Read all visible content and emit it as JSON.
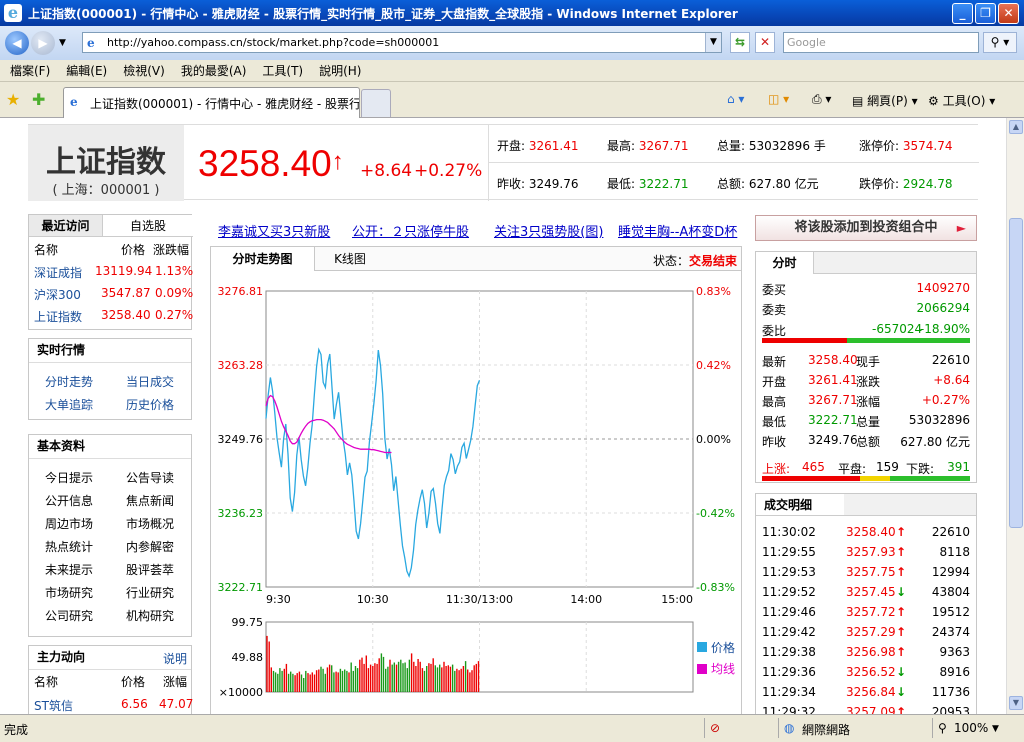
{
  "window": {
    "title": "上证指数(000001) - 行情中心 - 雅虎财经 - 股票行情_实时行情_股市_证券_大盘指数_全球股指 - Windows Internet Explorer",
    "address": "http://yahoo.compass.cn/stock/market.php?code=sh000001",
    "search_placeholder": "Google",
    "tab_title": "上证指数(000001) - 行情中心 - 雅虎财经 - 股票行...",
    "menu": [
      "檔案(F)",
      "編輯(E)",
      "檢視(V)",
      "我的最愛(A)",
      "工具(T)",
      "說明(H)"
    ],
    "toolbar_page": "網頁(P)",
    "toolbar_tools": "工具(O)",
    "status": "完成",
    "zone": "網際網路",
    "zoom": "100%"
  },
  "stock": {
    "name": "上证指数",
    "code": "( 上海：000001 )",
    "price": "3258.40",
    "change": "+8.64",
    "change_pct": "+0.27%",
    "quotes": [
      {
        "label": "开盘:",
        "value": "3261.41",
        "color": "red"
      },
      {
        "label": "最高:",
        "value": "3267.71",
        "color": "red"
      },
      {
        "label": "总量:",
        "value": "53032896 手",
        "color": "black"
      },
      {
        "label": "涨停价:",
        "value": "3574.74",
        "color": "red"
      },
      {
        "label": "昨收:",
        "value": "3249.76",
        "color": "black"
      },
      {
        "label": "最低:",
        "value": "3222.71",
        "color": "green"
      },
      {
        "label": "总额:",
        "value": "627.80 亿元",
        "color": "black"
      },
      {
        "label": "跌停价:",
        "value": "2924.78",
        "color": "green"
      }
    ]
  },
  "recent": {
    "tab_recent": "最近访问",
    "tab_watch": "自选股",
    "headers": [
      "名称",
      "价格",
      "涨跌幅"
    ],
    "rows": [
      {
        "name": "深证成指",
        "price": "13119.94",
        "pct": "1.13%"
      },
      {
        "name": "沪深300",
        "price": "3547.87",
        "pct": "0.09%"
      },
      {
        "name": "上证指数",
        "price": "3258.40",
        "pct": "0.27%"
      }
    ]
  },
  "realtime": {
    "title": "实时行情",
    "links": [
      "分时走势",
      "当日成交",
      "大单追踪",
      "历史价格"
    ]
  },
  "basics": {
    "title": "基本资料",
    "links": [
      "今日提示",
      "公告导读",
      "公开信息",
      "焦点新闻",
      "周边市场",
      "市场概况",
      "热点统计",
      "内参解密",
      "未来提示",
      "股评荟萃",
      "市场研究",
      "行业研究",
      "公司研究",
      "机构研究"
    ]
  },
  "main_force": {
    "title": "主力动向",
    "help": "说明",
    "headers": [
      "名称",
      "价格",
      "涨幅"
    ],
    "rows": [
      {
        "name": "ST筑信",
        "price": "6.56",
        "pct": "47.07"
      }
    ]
  },
  "news": [
    "李嘉诚又买3只新股",
    "公开：２只涨停牛股",
    "关注3只强势股(图)",
    "睡觉丰胸--A杯变D杯"
  ],
  "add_portfolio": "将该股添加到投资组合中",
  "chart": {
    "tab_intraday": "分时走势图",
    "tab_kline": "K线图",
    "state_label": "状态：",
    "state_value": "交易结束",
    "legend_price": "价格",
    "legend_avg": "均线",
    "vol_unit": "×10000"
  },
  "chart_data": {
    "type": "line",
    "y_ticks": [
      "3276.81",
      "3263.28",
      "3249.76",
      "3236.23",
      "3222.71"
    ],
    "pct_ticks": [
      "0.83%",
      "0.42%",
      "0.00%",
      "-0.42%",
      "-0.83%"
    ],
    "x_ticks": [
      "9:30",
      "10:30",
      "11:30/13:00",
      "14:00",
      "15:00"
    ],
    "ylim": [
      3222.71,
      3276.81
    ],
    "prev_close": 3249.76,
    "vol_ticks": [
      "99.75",
      "49.88"
    ],
    "vol_max": 99.75,
    "series": [
      {
        "name": "价格",
        "color": "#29a8e0",
        "values": [
          3253.5,
          3257.8,
          3261.0,
          3258.5,
          3254.5,
          3250.0,
          3247.2,
          3244.6,
          3249.8,
          3252.5,
          3247.0,
          3239.0,
          3236.5,
          3240.0,
          3246.8,
          3250.1,
          3246.0,
          3243.0,
          3241.2,
          3244.5,
          3249.0,
          3252.4,
          3258.0,
          3263.0,
          3266.1,
          3265.2,
          3260.1,
          3259.2,
          3263.5,
          3265.3,
          3259.2,
          3253.4,
          3256.1,
          3258.3,
          3254.0,
          3249.8,
          3247.1,
          3243.2,
          3245.4,
          3243.2,
          3238.4,
          3232.9,
          3231.5,
          3234.3,
          3238.5,
          3242.8,
          3243.9,
          3249.2,
          3252.6,
          3256.3,
          3260.4,
          3266.0,
          3263.2,
          3258.0,
          3249.8,
          3246.1,
          3248.0,
          3245.1,
          3240.3,
          3242.9,
          3238.5,
          3234.1,
          3230.2,
          3228.1,
          3225.6,
          3224.7,
          3226.2,
          3229.4,
          3234.1,
          3236.8,
          3238.9,
          3240.5,
          3238.0,
          3233.5,
          3236.2,
          3240.2,
          3240.7,
          3238.0,
          3234.3,
          3232.5,
          3237.1,
          3241.3,
          3242.9,
          3244.0,
          3247.1,
          3246.0,
          3243.4,
          3244.8,
          3245.6,
          3248.2,
          3249.0,
          3246.2,
          3247.8,
          3249.5,
          3252.0,
          3255.8,
          3259.5,
          3260.5
        ]
      },
      {
        "name": "均线",
        "color": "#e000c8",
        "values": [
          3255.8,
          3257.2,
          3257.7,
          3257.5,
          3256.7,
          3255.6,
          3254.3,
          3253.0,
          3252.0,
          3251.2,
          3250.4,
          3249.4,
          3248.9,
          3248.9,
          3249.2,
          3250.0,
          3250.8,
          3251.5,
          3252.1,
          3252.6,
          3252.9,
          3253.1,
          3253.2,
          3253.3,
          3253.3,
          3253.3,
          3253.2,
          3253.0,
          3252.8,
          3252.4,
          3252.0,
          3251.6,
          3251.0,
          3250.4,
          3249.9,
          3249.5,
          3249.1,
          3248.8,
          3248.6,
          3248.4,
          3248.2,
          3248.1,
          3248.0,
          3247.9,
          3247.9,
          3247.9,
          3247.9,
          3247.9,
          3247.8,
          3247.8,
          3247.7,
          3247.6,
          3247.5,
          3247.4,
          3247.3,
          3247.3,
          3247.3,
          3247.3
        ]
      }
    ],
    "volume": [
      80,
      72,
      35,
      30,
      28,
      26,
      34,
      30,
      33,
      40,
      26,
      29,
      26,
      24,
      27,
      29,
      25,
      20,
      30,
      27,
      25,
      28,
      25,
      31,
      32,
      36,
      33,
      26,
      35,
      39,
      38,
      28,
      29,
      28,
      33,
      30,
      32,
      30,
      28,
      42,
      30,
      37,
      34,
      46,
      49,
      40,
      52,
      34,
      39,
      37,
      41,
      40,
      48,
      55,
      50,
      33,
      36,
      46,
      39,
      42,
      39,
      43,
      46,
      41,
      42,
      34,
      46,
      55,
      43,
      37,
      47,
      43,
      34,
      30,
      37,
      41,
      40,
      48,
      38,
      35,
      39,
      35,
      43,
      37,
      38,
      36,
      39,
      30,
      33,
      31,
      33,
      37,
      44,
      32,
      28,
      31,
      38,
      40,
      44
    ]
  },
  "intraday": {
    "title": "分时",
    "buy_label": "委买",
    "buy_value": "1409270",
    "sell_label": "委卖",
    "sell_value": "2066294",
    "ratio_label": "委比",
    "ratio_value": "-657024",
    "ratio_pct": "-18.90%",
    "stats": [
      {
        "l": "最新",
        "v": "3258.40",
        "vc": "red",
        "l2": "现手",
        "v2": "22610",
        "v2c": "black"
      },
      {
        "l": "开盘",
        "v": "3261.41",
        "vc": "red",
        "l2": "涨跌",
        "v2": "+8.64",
        "v2c": "red"
      },
      {
        "l": "最高",
        "v": "3267.71",
        "vc": "red",
        "l2": "涨幅",
        "v2": "+0.27%",
        "v2c": "red"
      },
      {
        "l": "最低",
        "v": "3222.71",
        "vc": "green",
        "l2": "总量",
        "v2": "53032896",
        "v2c": "black"
      },
      {
        "l": "昨收",
        "v": "3249.76",
        "vc": "black",
        "l2": "总额",
        "v2": "627.80 亿元",
        "v2c": "black"
      }
    ],
    "up_label": "上涨:",
    "up_value": "465",
    "flat_label": "平盘:",
    "flat_value": "159",
    "down_label": "下跌:",
    "down_value": "391"
  },
  "trades": {
    "title": "成交明细",
    "rows": [
      {
        "time": "11:30:02",
        "price": "3258.40",
        "dir": "up",
        "vol": "22610"
      },
      {
        "time": "11:29:55",
        "price": "3257.93",
        "dir": "up",
        "vol": "8118"
      },
      {
        "time": "11:29:53",
        "price": "3257.75",
        "dir": "up",
        "vol": "12994"
      },
      {
        "time": "11:29:52",
        "price": "3257.45",
        "dir": "down",
        "vol": "43804"
      },
      {
        "time": "11:29:46",
        "price": "3257.72",
        "dir": "up",
        "vol": "19512"
      },
      {
        "time": "11:29:42",
        "price": "3257.29",
        "dir": "up",
        "vol": "24374"
      },
      {
        "time": "11:29:38",
        "price": "3256.98",
        "dir": "up",
        "vol": "9363"
      },
      {
        "time": "11:29:36",
        "price": "3256.52",
        "dir": "down",
        "vol": "8916"
      },
      {
        "time": "11:29:34",
        "price": "3256.84",
        "dir": "down",
        "vol": "11736"
      },
      {
        "time": "11:29:32",
        "price": "3257.09",
        "dir": "up",
        "vol": "20953"
      }
    ]
  }
}
